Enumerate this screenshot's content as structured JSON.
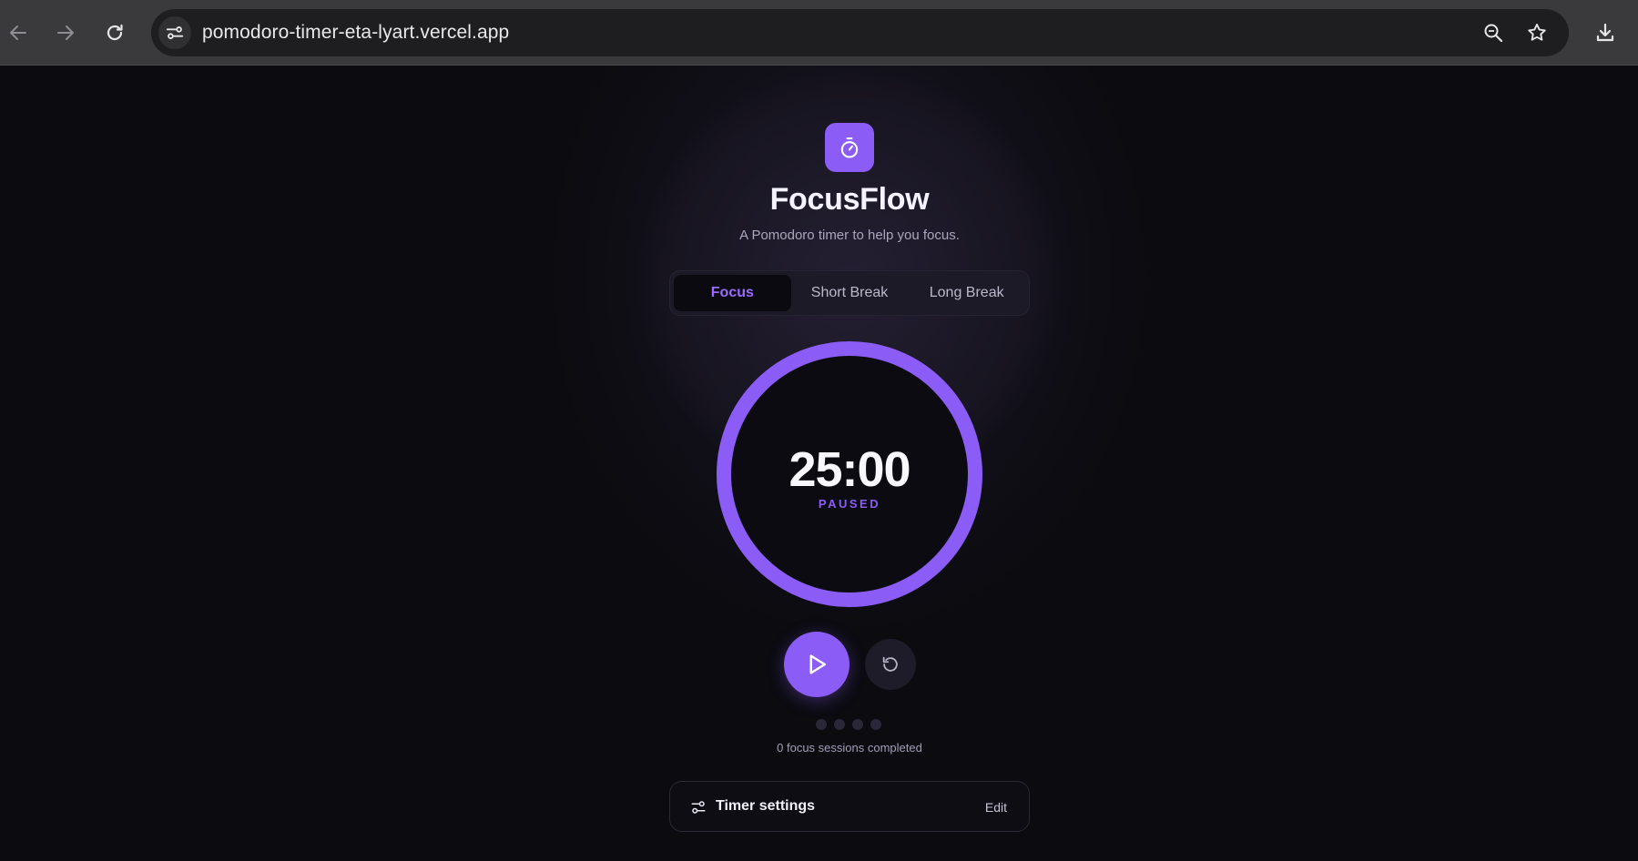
{
  "browser": {
    "url": "pomodoro-timer-eta-lyart.vercel.app",
    "icons": [
      "back-arrow-icon",
      "forward-arrow-icon",
      "reload-icon",
      "site-info-icon",
      "zoom-icon",
      "bookmark-star-icon",
      "download-icon"
    ]
  },
  "app": {
    "logo_icon": "stopwatch-icon",
    "title": "FocusFlow",
    "subtitle": "A Pomodoro timer to help you focus.",
    "accent_color": "#8b5cf6"
  },
  "modes": {
    "tabs": [
      {
        "label": "Focus",
        "active": true
      },
      {
        "label": "Short Break",
        "active": false
      },
      {
        "label": "Long Break",
        "active": false
      }
    ]
  },
  "timer": {
    "time": "25:00",
    "status": "PAUSED",
    "progress": 1.0
  },
  "controls": {
    "play_icon": "play-icon",
    "reset_icon": "reset-icon"
  },
  "sessions": {
    "dots_total": 4,
    "dots_completed": 0,
    "text": "0 focus sessions completed"
  },
  "settings": {
    "icon": "sliders-icon",
    "label": "Timer settings",
    "edit_label": "Edit"
  }
}
